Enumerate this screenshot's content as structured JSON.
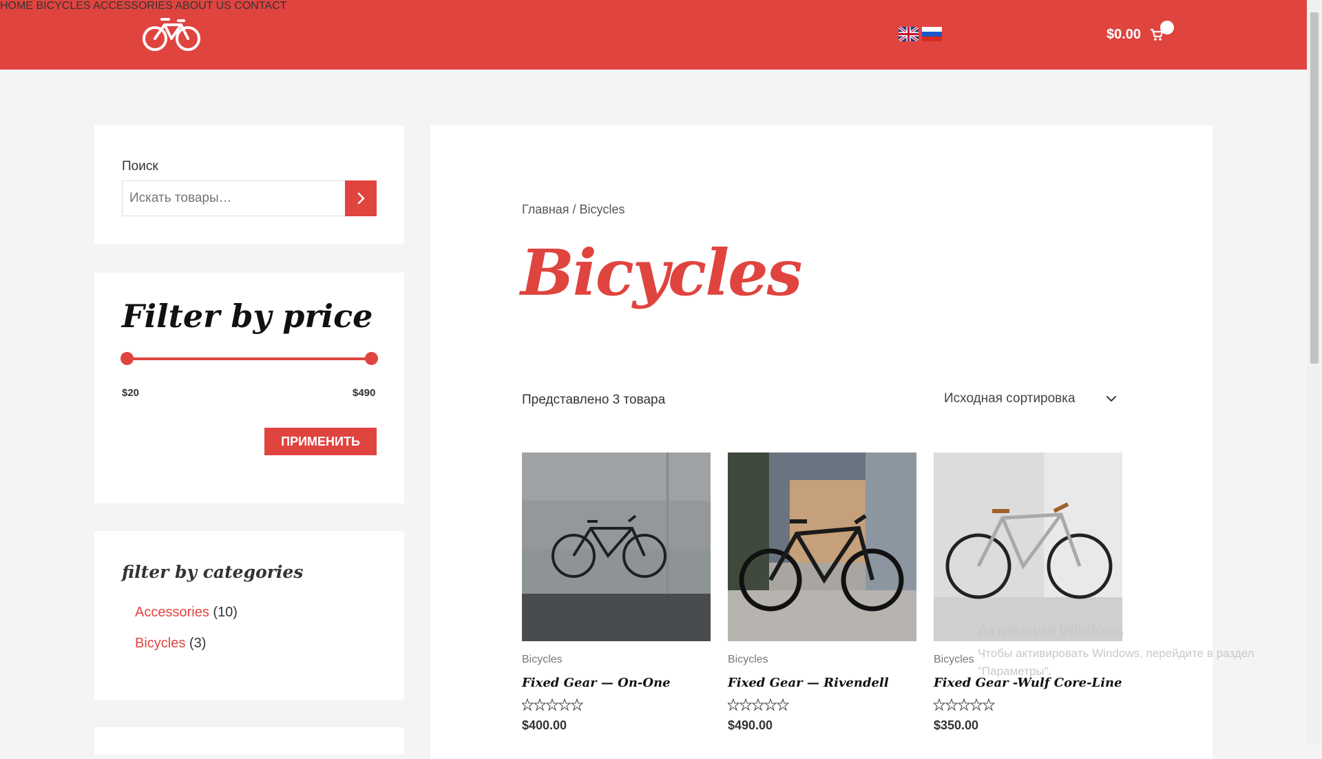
{
  "header": {
    "logo_icon": "bicycle-icon",
    "nav": [
      "HOME",
      "BICYCLES",
      "ACCESSORIES",
      "ABOUT US",
      "CONTACT"
    ],
    "languages": [
      "en-flag-icon",
      "ru-flag-icon"
    ],
    "cart_total": "$0.00",
    "cart_icon": "cart-icon"
  },
  "sidebar": {
    "search": {
      "label": "Поиск",
      "placeholder": "Искать товары…"
    },
    "price_filter": {
      "title": "Filter by price",
      "min_label": "$20",
      "max_label": "$490",
      "apply_label": "ПРИМЕНИТЬ"
    },
    "categories": {
      "title": "filter by categories",
      "items": [
        {
          "name": "Accessories",
          "count": "(10)"
        },
        {
          "name": "Bicycles",
          "count": "(3)"
        }
      ]
    }
  },
  "main": {
    "breadcrumb": "Главная / Bicycles",
    "title": "Bicycles",
    "result_count": "Представлено 3 товара",
    "sort_label": "Исходная сортировка",
    "products": [
      {
        "category": "Bicycles",
        "name": "Fixed Gear — On-One",
        "price": "$400.00",
        "rating": 0
      },
      {
        "category": "Bicycles",
        "name": "Fixed Gear — Rivendell",
        "price": "$490.00",
        "rating": 0
      },
      {
        "category": "Bicycles",
        "name": "Fixed Gear -Wulf Core-Line",
        "price": "$350.00",
        "rating": 0
      }
    ]
  },
  "watermark": {
    "line1": "Активация Windows",
    "line2": "Чтобы активировать Windows, перейдите в раздел",
    "line3": "\"Параметры\"."
  },
  "colors": {
    "accent": "#e0443f",
    "background": "#f4f4f4",
    "card": "#ffffff"
  }
}
